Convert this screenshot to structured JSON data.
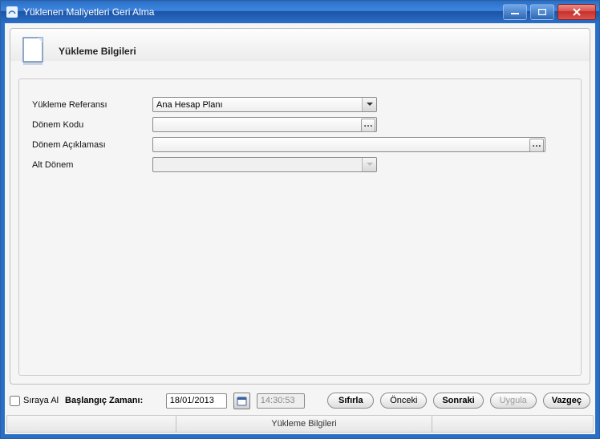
{
  "window": {
    "title": "Yüklenen Maliyetleri Geri Alma"
  },
  "header": {
    "title": "Yükleme Bilgileri"
  },
  "form": {
    "yukleme_referansi": {
      "label": "Yükleme Referansı",
      "value": "Ana Hesap Planı"
    },
    "donem_kodu": {
      "label": "Dönem Kodu",
      "value": ""
    },
    "donem_aciklamasi": {
      "label": "Dönem Açıklaması",
      "value": ""
    },
    "alt_donem": {
      "label": "Alt Dönem",
      "value": ""
    }
  },
  "footer": {
    "siraya_al": "Sıraya Al",
    "baslangic_zamani_label": "Başlangıç Zamanı:",
    "date_value": "18/01/2013",
    "time_value": "14:30:53",
    "buttons": {
      "reset": "Sıfırla",
      "prev": "Önceki",
      "next": "Sonraki",
      "apply": "Uygula",
      "cancel": "Vazgeç"
    }
  },
  "statusbar": {
    "text": "Yükleme Bilgileri"
  }
}
